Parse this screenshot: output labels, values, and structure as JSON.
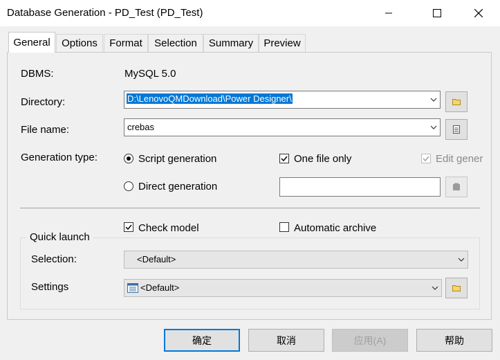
{
  "window": {
    "title": "Database Generation - PD_Test (PD_Test)"
  },
  "tabs": [
    "General",
    "Options",
    "Format",
    "Selection",
    "Summary",
    "Preview"
  ],
  "general": {
    "dbms_label": "DBMS:",
    "dbms_value": "MySQL 5.0",
    "directory_label": "Directory:",
    "directory_value": "D:\\LenovoQMDownload\\Power Designer\\",
    "filename_label": "File name:",
    "filename_value": "crebas",
    "gentype_label": "Generation type:",
    "script_generation": "Script generation",
    "direct_generation": "Direct generation",
    "one_file_only": "One file only",
    "edit_generation": "Edit gener",
    "check_model": "Check model",
    "automatic_archive": "Automatic archive",
    "quick_launch": "Quick launch",
    "selection_label": "Selection:",
    "selection_value": "<Default>",
    "settings_label": "Settings",
    "settings_value": "<Default>"
  },
  "states": {
    "script_generation_selected": true,
    "one_file_only_checked": true,
    "edit_generation_checked": true,
    "edit_generation_enabled": false,
    "check_model_checked": true,
    "automatic_archive_checked": false
  },
  "buttons": {
    "ok": "确定",
    "cancel": "取消",
    "apply": "应用(A)",
    "help": "帮助"
  },
  "icons": [
    "minimize-icon",
    "maximize-icon",
    "close-icon",
    "folder-icon",
    "file-icon",
    "properties-icon"
  ],
  "colors": {
    "selection_highlight": "#0078d7",
    "default_button_border": "#0078d7"
  }
}
